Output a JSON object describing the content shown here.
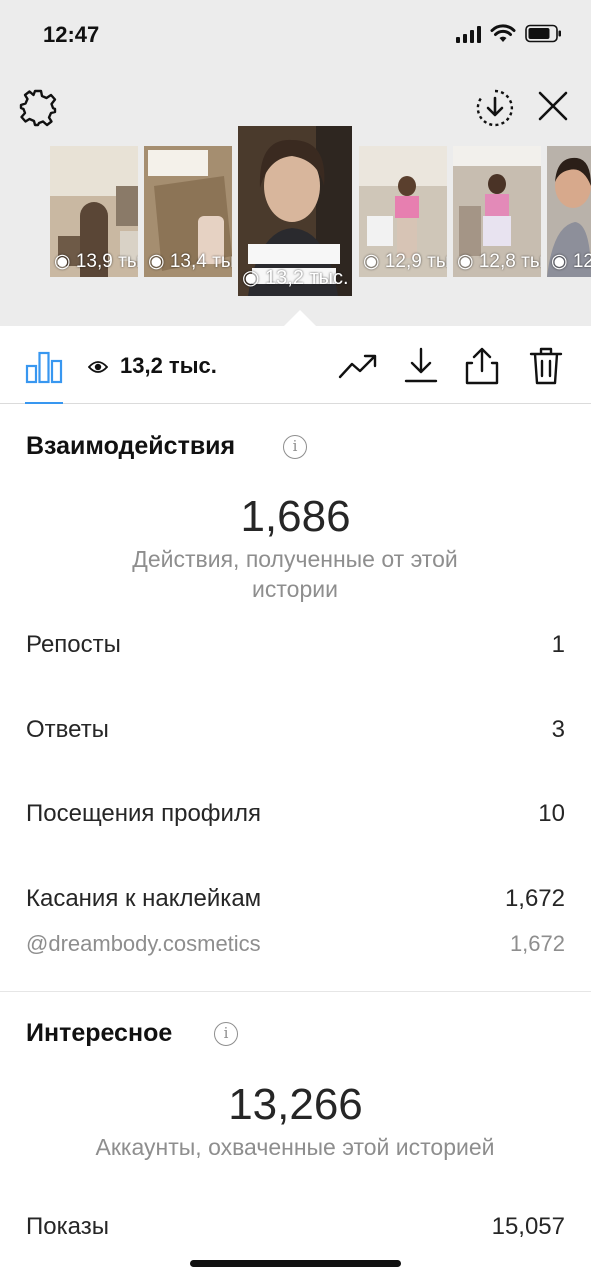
{
  "status_bar": {
    "time": "12:47"
  },
  "stories": [
    {
      "views": "13,9 тыс."
    },
    {
      "views": "13,4 тыс."
    },
    {
      "views": "13,2 тыс."
    },
    {
      "views": "12,9 тыс."
    },
    {
      "views": "12,8 тыс."
    },
    {
      "views": "12,…"
    }
  ],
  "toolbar": {
    "views": "13,2 тыс."
  },
  "interactions": {
    "title": "Взаимодействия",
    "total": "1,686",
    "total_desc": "Действия, полученные от этой истории",
    "rows": [
      {
        "label": "Репосты",
        "value": "1"
      },
      {
        "label": "Ответы",
        "value": "3"
      },
      {
        "label": "Посещения профиля",
        "value": "10"
      },
      {
        "label": "Касания к наклейкам",
        "value": "1,672"
      }
    ],
    "sticker": {
      "label": "@dreambody.cosmetics",
      "value": "1,672"
    }
  },
  "discovery": {
    "title": "Интересное",
    "total": "13,266",
    "total_desc": "Аккаунты, охваченные этой историей",
    "rows": [
      {
        "label": "Показы",
        "value": "15,057"
      }
    ]
  },
  "colors": {
    "accent": "#3897f0",
    "text": "#262626",
    "muted": "#8e8e8e",
    "top_bg": "#ececec"
  }
}
